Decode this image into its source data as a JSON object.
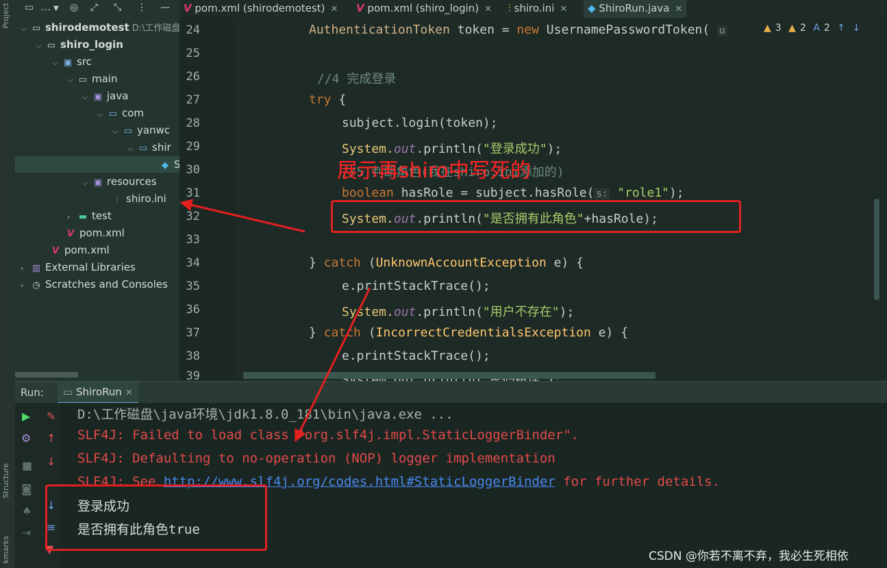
{
  "left_strip": {
    "project_label": "Project",
    "structure_label": "Structure",
    "bookmarks_label": "kmarks"
  },
  "project_toolbar": {
    "menu_label": "…"
  },
  "tree": [
    {
      "label": "shirodemotest",
      "hint": "D:\\工作磁盘",
      "bold": true
    },
    {
      "label": "shiro_login",
      "bold": true
    },
    {
      "label": "src"
    },
    {
      "label": "main"
    },
    {
      "label": "java"
    },
    {
      "label": "com"
    },
    {
      "label": "yanwc"
    },
    {
      "label": "shir"
    },
    {
      "label": "S"
    },
    {
      "label": "resources"
    },
    {
      "label": "shiro.ini"
    },
    {
      "label": "test"
    },
    {
      "label": "pom.xml"
    },
    {
      "label": "pom.xml"
    },
    {
      "label": "External Libraries"
    },
    {
      "label": "Scratches and Consoles"
    }
  ],
  "tabs": [
    {
      "label": "pom.xml (shirodemotest)"
    },
    {
      "label": "pom.xml (shiro_login)"
    },
    {
      "label": "shiro.ini"
    },
    {
      "label": "ShiroRun.java"
    }
  ],
  "editor_status": {
    "warnings": "3",
    "weak_warnings": "2",
    "typos": "2"
  },
  "line_numbers": [
    "24",
    "25",
    "26",
    "27",
    "28",
    "29",
    "30",
    "31",
    "32",
    "33",
    "34",
    "35",
    "36",
    "37",
    "38",
    "39"
  ],
  "code": {
    "l24_type": "AuthenticationToken",
    "l24_var": " token = ",
    "l24_new": "new",
    "l24_ctor": " UsernamePasswordToken(",
    "l24_hint": "u",
    "l26": "//4 完成登录",
    "l27_kw": "try",
    "l27_rest": " {",
    "l28": "subject.login(token);",
    "l29_sys": "System.",
    "l29_out": "out",
    "l29_call": ".println(",
    "l29_str": "\"登录成功\"",
    "l29_end": ");",
    "l30": "//5 判断角色(我在shiro.ini添加的)",
    "l31_kw": "boolean",
    "l31_mid": " hasRole = subject.hasRole(",
    "l31_hint": "s:",
    "l31_str": " \"role1\"",
    "l31_end": ");",
    "l32_sys": "System.",
    "l32_out": "out",
    "l32_call": ".println(",
    "l32_str": "\"是否拥有此角色\"",
    "l32_end": "+hasRole);",
    "l34_brace": "} ",
    "l34_kw": "catch",
    "l34_open": " (",
    "l34_cls": "UnknownAccountException",
    "l34_end": " e) {",
    "l35": "e.printStackTrace();",
    "l36_sys": "System.",
    "l36_out": "out",
    "l36_call": ".println(",
    "l36_str": "\"用户不存在\"",
    "l36_end": ");",
    "l37_brace": "} ",
    "l37_kw": "catch",
    "l37_open": " (",
    "l37_cls": "IncorrectCredentialsException",
    "l37_end": " e) {",
    "l38": "e.printStackTrace();",
    "l39": "System.out.println(\"密码错误\");"
  },
  "run": {
    "label": "Run:",
    "tab": "ShiroRun"
  },
  "console": [
    {
      "text": "D:\\工作磁盘\\java环境\\jdk1.8.0_181\\bin\\java.exe ...",
      "kind": "dim"
    },
    {
      "text": "SLF4J: Failed to load class \"org.slf4j.impl.StaticLoggerBinder\".",
      "kind": "err"
    },
    {
      "text": "SLF4J: Defaulting to no-operation (NOP) logger implementation",
      "kind": "err"
    },
    {
      "text": "登录成功",
      "kind": "ok"
    },
    {
      "text": "是否拥有此角色true",
      "kind": "ok"
    }
  ],
  "console_see": {
    "prefix": "SLF4J: See ",
    "link": "http://www.slf4j.org/codes.html#StaticLoggerBinder",
    "suffix": " for further details."
  },
  "annotation": {
    "text": "展示再shiro中写死的"
  },
  "watermark": "CSDN @你若不离不弃，我必生死相依",
  "colors": {
    "accent": "#5fa5e0",
    "annotation_red": "#e32020",
    "error_red": "#e24a4a",
    "link_blue": "#4a88f0"
  }
}
